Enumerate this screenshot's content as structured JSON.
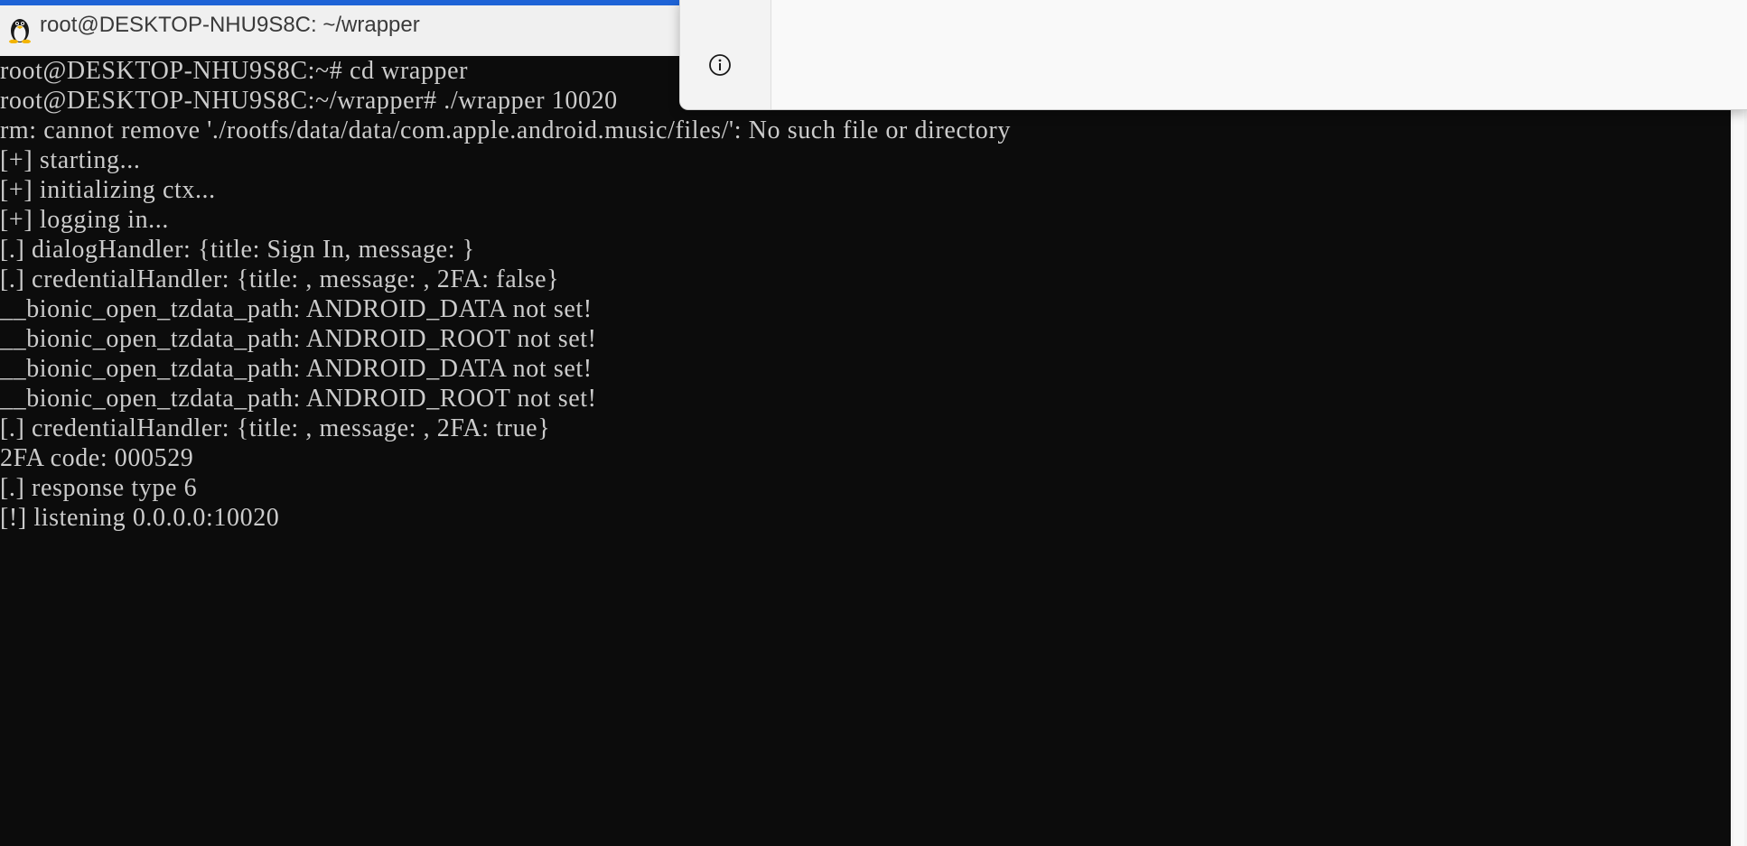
{
  "window": {
    "title": "root@DESKTOP-NHU9S8C: ~/wrapper",
    "app_icon": "linux-penguin-icon"
  },
  "overlay": {
    "icon": "info-icon"
  },
  "terminal": {
    "lines": [
      "root@DESKTOP-NHU9S8C:~# cd wrapper",
      "root@DESKTOP-NHU9S8C:~/wrapper# ./wrapper 10020",
      "rm: cannot remove './rootfs/data/data/com.apple.android.music/files/': No such file or directory",
      "[+] starting...",
      "[+] initializing ctx...",
      "[+] logging in...",
      "[.] dialogHandler: {title: Sign In, message: }",
      "[.] credentialHandler: {title: , message: , 2FA: false}",
      "__bionic_open_tzdata_path: ANDROID_DATA not set!",
      "__bionic_open_tzdata_path: ANDROID_ROOT not set!",
      "__bionic_open_tzdata_path: ANDROID_DATA not set!",
      "__bionic_open_tzdata_path: ANDROID_ROOT not set!",
      "[.] credentialHandler: {title: , message: , 2FA: true}",
      "2FA code: 000529",
      "[.] response type 6",
      "[!] listening 0.0.0.0:10020"
    ]
  },
  "colors": {
    "terminal_bg": "#0c0c0c",
    "terminal_fg": "#cccccc",
    "titlebar_bg": "#f0f0f0",
    "accent": "#1e63d6"
  }
}
